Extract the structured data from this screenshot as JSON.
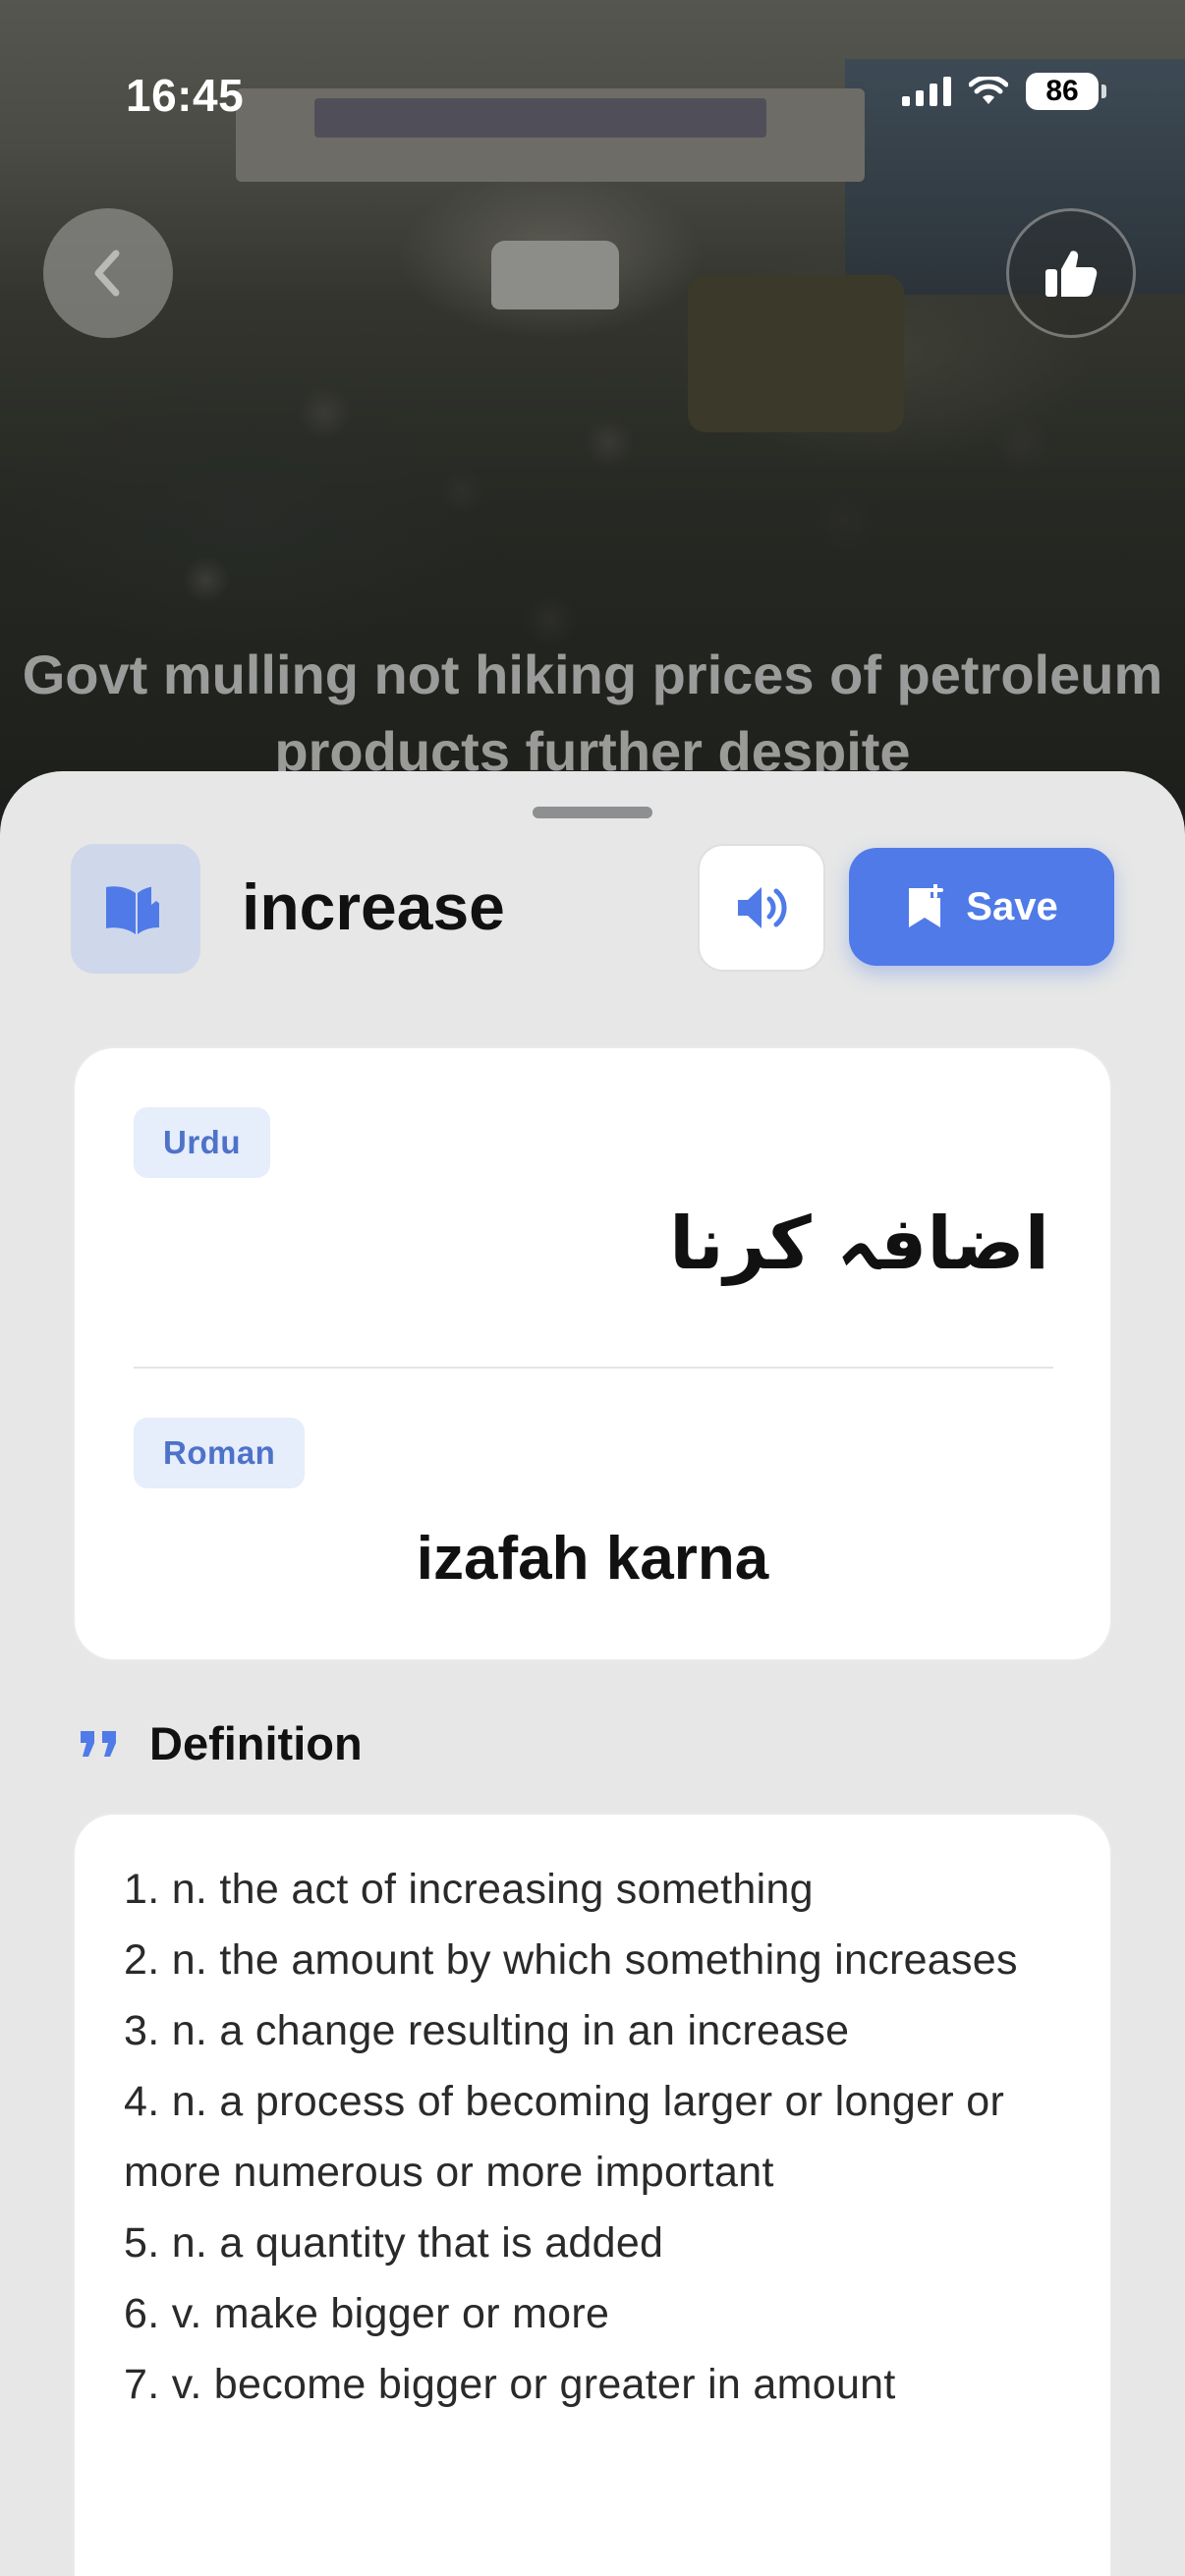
{
  "status_bar": {
    "time": "16:45",
    "battery": "86"
  },
  "article": {
    "headline": "Govt mulling not hiking prices of petroleum products further despite"
  },
  "icons": {
    "back": "chevron-left-icon",
    "like": "thumbs-up-icon",
    "book": "open-book-icon",
    "speaker": "speaker-icon",
    "bookmark": "bookmark-add-icon",
    "quote": "quote-icon"
  },
  "colors": {
    "accent": "#4f7ae8",
    "tag_bg": "#e6edfb",
    "tag_text": "#4e72c9",
    "sheet_bg": "#e6e7e6"
  },
  "word_panel": {
    "word": "increase",
    "save_label": "Save"
  },
  "translation": {
    "urdu_label": "Urdu",
    "urdu_text": "اضافہ کرنا",
    "roman_label": "Roman",
    "roman_text": "izafah karna"
  },
  "definition": {
    "heading": "Definition",
    "items": [
      "1. n. the act of increasing something",
      "2. n. the amount by which something increases",
      "3. n. a change resulting in an increase",
      "4. n. a process of becoming larger or longer or more numerous or more important",
      "5. n. a quantity that is added",
      "6. v. make bigger or more",
      "7. v. become bigger or greater in amount"
    ]
  }
}
